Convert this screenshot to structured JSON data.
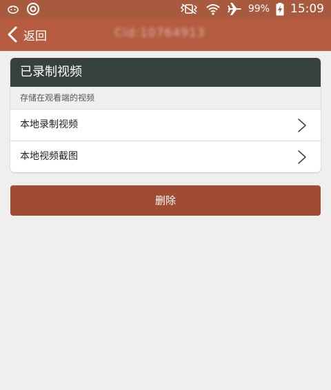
{
  "status_bar": {
    "icons_left": [
      "notification-icon",
      "circle-app-icon"
    ],
    "icons_right": [
      "vibrate-icon",
      "wifi-icon",
      "airplane-icon",
      "battery-charging-icon"
    ],
    "battery": "99%",
    "time": "15:09"
  },
  "title_bar": {
    "back_label": "返回",
    "device_id": "Cid:10764913"
  },
  "recorded_card": {
    "title": "已录制视频",
    "subtitle": "存储在观看端的视频",
    "items": [
      {
        "label": "本地录制视频"
      },
      {
        "label": "本地视频截图"
      }
    ]
  },
  "delete_label": "删除",
  "colors": {
    "status_bar": "#a85a3e",
    "title_bar": "#b55c40",
    "card_header": "#36403f",
    "delete_button": "#9f4c33",
    "background": "#efefef"
  }
}
